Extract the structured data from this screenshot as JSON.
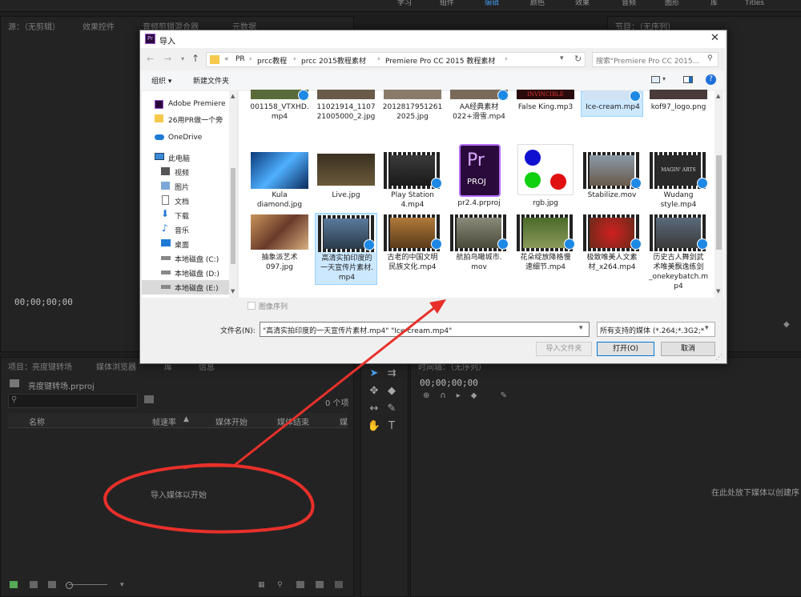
{
  "workspace": {
    "tabs": [
      "学习",
      "组件",
      "编辑",
      "颜色",
      "效果",
      "音频",
      "图形",
      "库",
      "Titles"
    ],
    "active": "编辑"
  },
  "source_panel": {
    "tabs": [
      "源：（无剪辑）",
      "效果控件",
      "音频剪辑混合器",
      "元数据"
    ],
    "timecode": "00;00;00;00"
  },
  "program_panel": {
    "tabs": [
      "节目：（无序列）"
    ]
  },
  "project_panel": {
    "tabs": [
      "项目：亮度键转场",
      "媒体浏览器",
      "库",
      "信息"
    ],
    "file": "亮度键转场.prproj",
    "item_count": "0 个项",
    "columns": [
      "名称",
      "帧速率",
      "媒体开始",
      "媒体结束",
      "媒"
    ],
    "empty_hint": "导入媒体以开始"
  },
  "timeline_panel": {
    "tabs": [
      "时间轴：（无序列）"
    ],
    "timecode": "00;00;00;00",
    "drop_hint": "在此处放下媒体以创建序"
  },
  "dialog": {
    "title": "导入",
    "breadcrumb": [
      "«",
      "PR",
      "prcc教程",
      "prcc 2015教程素材",
      "Premiere Pro CC 2015 教程素材"
    ],
    "search_placeholder": "搜索\"Premiere Pro CC 2015...",
    "organize": "组织 ▾",
    "new_folder": "新建文件夹",
    "nav": [
      {
        "label": "Adobe Premiere",
        "icon": "premiere-icon"
      },
      {
        "label": "26用PR做一个旁",
        "icon": "folder-icon"
      },
      {
        "label": "OneDrive",
        "icon": "cloud-icon"
      },
      {
        "label": "此电脑",
        "icon": "computer-icon"
      },
      {
        "label": "视频",
        "icon": "video-icon"
      },
      {
        "label": "图片",
        "icon": "picture-icon"
      },
      {
        "label": "文档",
        "icon": "document-icon"
      },
      {
        "label": "下载",
        "icon": "download-icon"
      },
      {
        "label": "音乐",
        "icon": "music-icon"
      },
      {
        "label": "桌面",
        "icon": "desktop-icon"
      },
      {
        "label": "本地磁盘 (C:)",
        "icon": "drive-icon"
      },
      {
        "label": "本地磁盘 (D:)",
        "icon": "drive-icon"
      },
      {
        "label": "本地磁盘 (E:)",
        "icon": "drive-icon"
      }
    ],
    "files_row1": [
      "001158_VTXHD.\nmp4",
      "11021914_1107\n21005000_2.jpg",
      "2012817951261\n2025.jpg",
      "AA经典素材\n022+滑雪.mp4",
      "False King.mp3",
      "Ice-cream.mp4",
      "kof97_logo.png"
    ],
    "files_row2": [
      "Kula\ndiamond.jpg",
      "Live.jpg",
      "Play Station\n4.mp4",
      "pr2.4.prproj",
      "rgb.jpg",
      "Stabilize.mov",
      "Wudang\nstyle.mp4"
    ],
    "files_row3": [
      "抽象派艺术\n097.jpg",
      "高清实拍印度的\n一天宣传片素材.\nmp4",
      "古老的中国文明\n民族文化.mp4",
      "航拍鸟瞰城市.\nmov",
      "花朵绽放降格慢\n速细节.mp4",
      "极致唯美人文素\n材_x264.mp4",
      "历史古人舞剑武\n术唯美飘逸练剑\n_onekeybatch.m\np4"
    ],
    "thumb_texts": {
      "invincible": "INVINCIBLE",
      "magin": "MAGIN' ARTS",
      "pr": "Pr",
      "proj": "PROJ"
    },
    "image_sequence": "图像序列",
    "filename_label": "文件名(N):",
    "filename_value": "\"高清实拍印度的一天宣传片素材.mp4\" \"Ice-cream.mp4\"",
    "filter_value": "所有支持的媒体 (*.264;*.3G2;*",
    "btn_import_folder": "导入文件夹",
    "btn_open": "打开(O)",
    "btn_cancel": "取消"
  },
  "annotation_color": "#e8302a"
}
